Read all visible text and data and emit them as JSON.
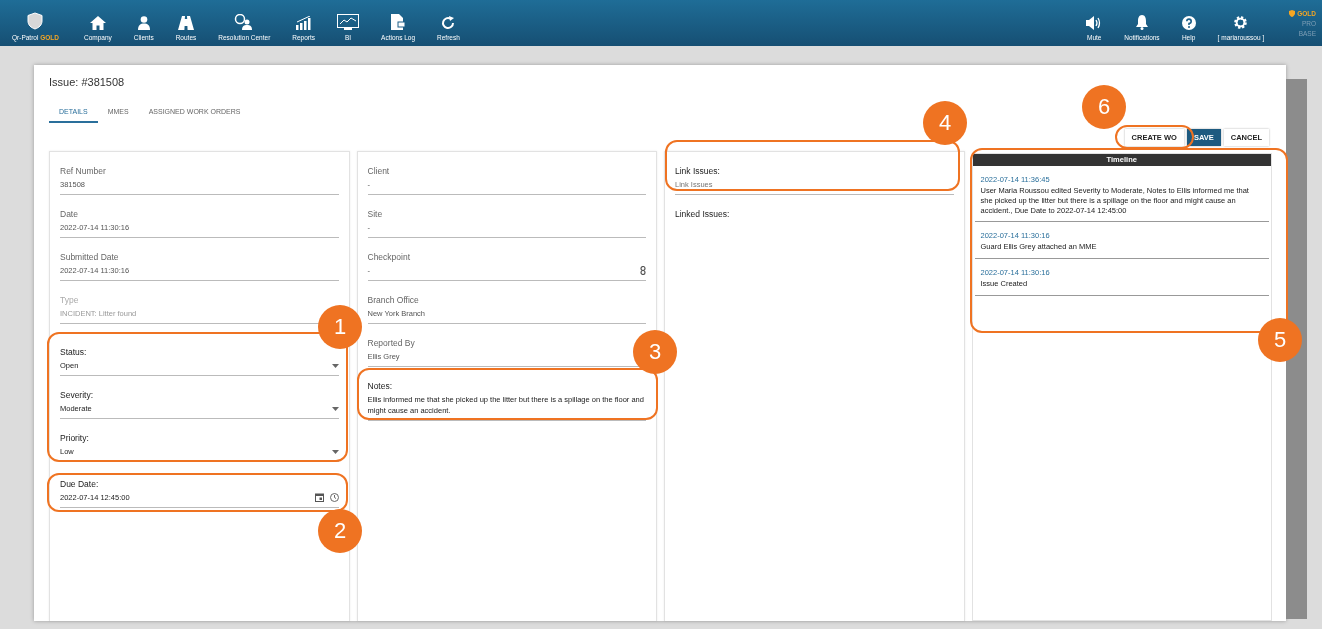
{
  "nav": {
    "brand": {
      "name": "Qr-Patrol",
      "tier": "GOLD"
    },
    "items": [
      {
        "label": "Company"
      },
      {
        "label": "Clients"
      },
      {
        "label": "Routes"
      },
      {
        "label": "Resolution Center"
      },
      {
        "label": "Reports"
      },
      {
        "label": "BI"
      },
      {
        "label": "Actions Log"
      },
      {
        "label": "Refresh"
      }
    ],
    "right_items": [
      {
        "label": "Mute"
      },
      {
        "label": "Notifications"
      },
      {
        "label": "Help"
      },
      {
        "label": "[ mariaroussou ]"
      }
    ],
    "plans": [
      {
        "label": "GOLD",
        "selected": true
      },
      {
        "label": "PRO",
        "selected": false
      },
      {
        "label": "BASE",
        "selected": false
      }
    ]
  },
  "dialog": {
    "title": "Issue: #381508",
    "tabs": [
      {
        "label": "DETAILS",
        "selected": true
      },
      {
        "label": "MMES",
        "selected": false
      },
      {
        "label": "ASSIGNED WORK ORDERS",
        "selected": false
      }
    ],
    "buttons": [
      {
        "label": "CREATE WO",
        "primary": false
      },
      {
        "label": "SAVE",
        "primary": true
      },
      {
        "label": "CANCEL",
        "primary": false
      }
    ],
    "columns": [
      {
        "fields": [
          {
            "kind": "text",
            "label": "Ref Number",
            "value": "381508",
            "disabled": false
          },
          {
            "kind": "text",
            "label": "Date",
            "value": "2022-07-14 11:30:16",
            "disabled": false
          },
          {
            "kind": "text",
            "label": "Submitted Date",
            "value": "2022-07-14 11:30:16",
            "disabled": false
          },
          {
            "kind": "text",
            "label": "Type",
            "value": "INCIDENT: Litter found",
            "disabled": true
          },
          {
            "kind": "select",
            "label": "Status:",
            "value": "Open",
            "disabled": false
          },
          {
            "kind": "select",
            "label": "Severity:",
            "value": "Moderate",
            "disabled": false
          },
          {
            "kind": "select",
            "label": "Priority:",
            "value": "Low",
            "disabled": false
          },
          {
            "kind": "datetime",
            "label": "Due Date:",
            "value": "2022-07-14 12:45:00",
            "disabled": false
          }
        ]
      },
      {
        "fields": [
          {
            "kind": "text",
            "label": "Client",
            "value": "-",
            "disabled": false
          },
          {
            "kind": "text",
            "label": "Site",
            "value": "-",
            "disabled": false
          },
          {
            "kind": "picker",
            "label": "Checkpoint",
            "value": "-",
            "disabled": false
          },
          {
            "kind": "text",
            "label": "Branch Office",
            "value": "New York Branch",
            "disabled": false
          },
          {
            "kind": "text",
            "label": "Reported By",
            "value": "Ellis Grey",
            "disabled": false
          },
          {
            "kind": "notes",
            "label": "Notes:",
            "value": "Ellis informed me that she picked up the litter but there is a spillage on the floor and might cause an accident.",
            "disabled": false
          }
        ]
      },
      {
        "fields": [
          {
            "kind": "input",
            "label": "Link Issues:",
            "placeholder": "Link Issues",
            "disabled": false
          },
          {
            "kind": "heading",
            "label": "Linked Issues:",
            "disabled": false
          }
        ]
      }
    ],
    "timeline": {
      "title": "Timeline",
      "entries": [
        {
          "time": "2022-07-14 11:36:45",
          "text": "User Maria Roussou edited Severity to Moderate, Notes to Ellis informed me that she picked up the litter but there is a spillage on the floor and might cause an accident., Due Date to 2022-07-14 12:45:00"
        },
        {
          "time": "2022-07-14 11:30:16",
          "text": "Guard Ellis Grey attached an MME"
        },
        {
          "time": "2022-07-14 11:30:16",
          "text": "Issue Created"
        }
      ]
    }
  },
  "callouts": [
    {
      "number": "1"
    },
    {
      "number": "2"
    },
    {
      "number": "3"
    },
    {
      "number": "4"
    },
    {
      "number": "5"
    },
    {
      "number": "6"
    }
  ]
}
